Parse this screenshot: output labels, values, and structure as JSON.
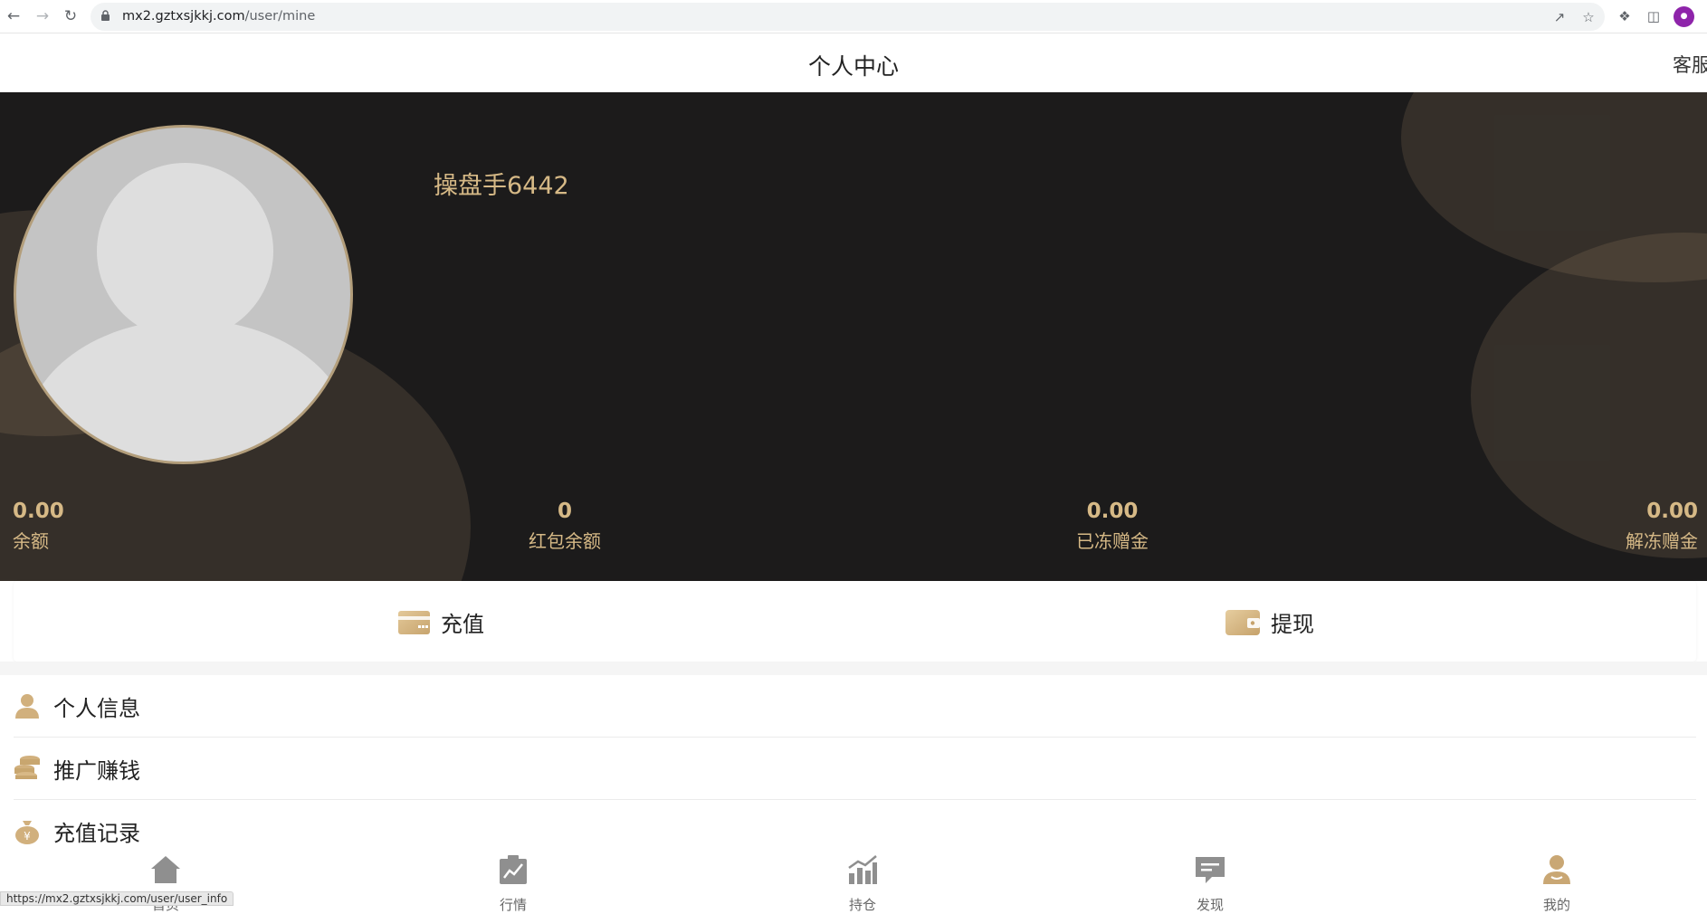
{
  "browser": {
    "url_host": "mx2.gztxsjkkj.com",
    "url_path": "/user/mine",
    "status_url": "https://mx2.gztxsjkkj.com/user/user_info"
  },
  "header": {
    "title": "个人中心",
    "service_label": "客服"
  },
  "profile": {
    "username": "操盘手6442"
  },
  "stats": [
    {
      "value": "0.00",
      "label": "余额"
    },
    {
      "value": "0",
      "label": "红包余额"
    },
    {
      "value": "0.00",
      "label": "已冻赠金"
    },
    {
      "value": "0.00",
      "label": "解冻赠金"
    }
  ],
  "actions": {
    "recharge": "充值",
    "withdraw": "提现"
  },
  "menu": [
    {
      "label": "个人信息",
      "icon": "user-icon"
    },
    {
      "label": "推广赚钱",
      "icon": "coins-icon"
    },
    {
      "label": "充值记录",
      "icon": "money-bag-icon"
    }
  ],
  "tabs": [
    {
      "label": "首页",
      "icon": "home-icon"
    },
    {
      "label": "行情",
      "icon": "market-chart-icon"
    },
    {
      "label": "持仓",
      "icon": "position-chart-icon"
    },
    {
      "label": "发现",
      "icon": "discover-icon"
    },
    {
      "label": "我的",
      "icon": "mine-icon"
    }
  ],
  "colors": {
    "gold": "#d6b986",
    "hero_bg": "#1c1b1b",
    "tab_icon": "#8f8f8f",
    "tab_active": "#c9a774"
  }
}
